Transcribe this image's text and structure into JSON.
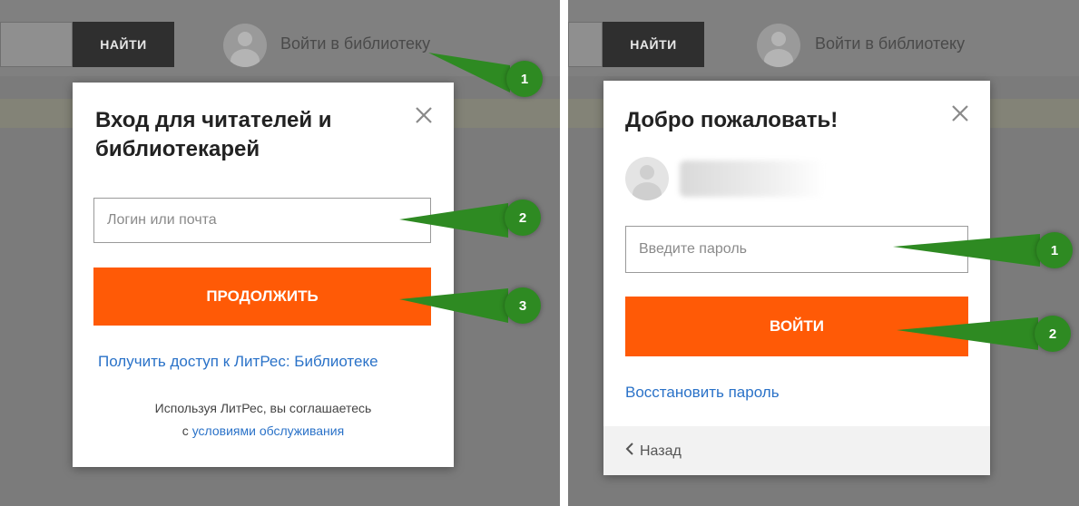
{
  "left": {
    "header": {
      "search_button": "НАЙТИ",
      "login_link": "Войти в библиотеку"
    },
    "modal": {
      "title_line1": "Вход для читателей и",
      "title_line2": "библиотекарей",
      "login_placeholder": "Логин или почта",
      "continue_button": "ПРОДОЛЖИТЬ",
      "access_link": "Получить доступ к ЛитРес: Библиотеке",
      "terms_text": "Используя ЛитРес, вы соглашаетесь",
      "terms_prefix": "с",
      "terms_link": "условиями обслуживания"
    },
    "callouts": [
      "1",
      "2",
      "3"
    ]
  },
  "right": {
    "header": {
      "search_button": "НАЙТИ",
      "login_link": "Войти в библиотеку"
    },
    "modal": {
      "title": "Добро пожаловать!",
      "password_placeholder": "Введите пароль",
      "login_button": "ВОЙТИ",
      "restore_link": "Восстановить пароль",
      "back_label": "Назад"
    },
    "callouts": [
      "1",
      "2"
    ]
  },
  "colors": {
    "accent": "#ff5a06",
    "link": "#2a72c8",
    "badge": "#2e8a22",
    "overlay": "#7b7b7b"
  },
  "icons": [
    "avatar-icon",
    "close-icon",
    "chevron-left-icon"
  ]
}
